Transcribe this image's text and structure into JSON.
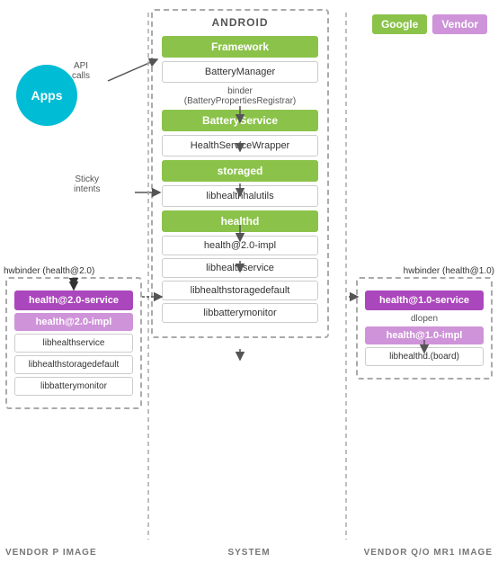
{
  "topLabels": {
    "google": "Google",
    "vendor": "Vendor"
  },
  "androidBox": {
    "title": "ANDROID",
    "framework": "Framework",
    "batteryManager": "BatteryManager",
    "binderLabel": "binder\n(BatteryPropertiesRegistrar)",
    "batteryService": "BatteryService",
    "healthServiceWrapper": "HealthServiceWrapper",
    "storaged": "storaged",
    "libhealthhalutils": "libhealthhalutils",
    "healthd": "healthd",
    "healthImplAndroid": "health@2.0-impl",
    "libhealthserviceAndroid": "libhealthservice",
    "libhealthstoragedefaultAndroid": "libhealthstoragedefault",
    "libbatterymonitorAndroid": "libbatterymonitor"
  },
  "appsCircle": {
    "label": "Apps"
  },
  "annotations": {
    "apiCalls": "API\ncalls",
    "stickyIntents": "Sticky\nintents",
    "hwbinderLeft": "hwbinder (health@2.0)",
    "hwbinderRight": "hwbinder (health@1.0)",
    "dlopenLabel": "dlopen"
  },
  "vendorP": {
    "title": "VENDOR P IMAGE",
    "healthService": "health@2.0-service",
    "healthImpl": "health@2.0-impl",
    "libhealthservice": "libhealthservice",
    "libhealthstoragedefault": "libhealthstoragedefault",
    "libbatterymonitor": "libbatterymonitor"
  },
  "vendorQ": {
    "title": "VENDOR Q/O MR1 IMAGE",
    "healthService": "health@1.0-service",
    "healthImpl": "health@1.0-impl",
    "libhealthdBoard": "libhealthd.(board)"
  },
  "bottomLabels": {
    "vendorP": "VENDOR P IMAGE",
    "system": "SYSTEM",
    "vendorQ": "VENDOR Q/O MR1 IMAGE"
  }
}
